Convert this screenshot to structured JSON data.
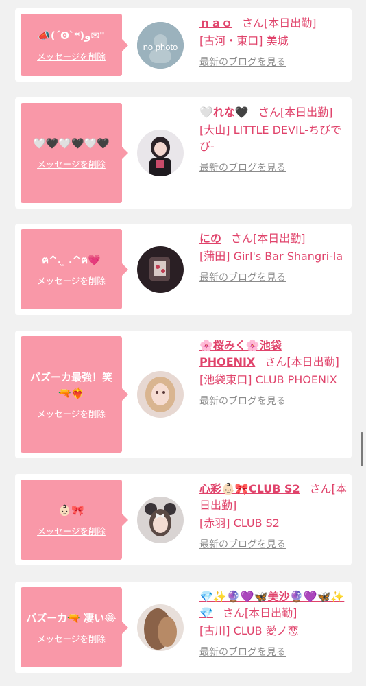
{
  "delete_label": "メッセージを削除",
  "blog_label": "最新のブログを見る",
  "cards": [
    {
      "message": "📣(´ʘ`*)و✉\"",
      "name": "ｎａｏ",
      "san": "さん[本日出勤]",
      "shop": "[古河・東口] 美城",
      "avatar": "no-photo",
      "avatar_text": "no photo"
    },
    {
      "message": "🤍🖤🤍🖤🤍🖤",
      "name": "🤍れな🖤",
      "san": "さん[本日出勤]",
      "shop": "[大山] LITTLE DEVIL-ちびでび-",
      "avatar": "photo-girl-black-dress"
    },
    {
      "message": "ฅ^. ̫ .^ฅ💗",
      "name": "にの",
      "san": "さん[本日出勤]",
      "shop": "[蒲田] Girl's Bar Shangri-la",
      "avatar": "photo-dark-mirror"
    },
    {
      "message": "バズーカ最強！笑🔫❤️‍🔥",
      "name": "🌸桜みく🌸池袋PHOENIX",
      "san": "さん[本日出勤]",
      "shop": "[池袋東口] CLUB PHOENIX",
      "avatar": "photo-blonde-girl"
    },
    {
      "message": "👶🏻🎀",
      "name": "心彩👶🏻🎀CLUB S2",
      "san": "さん[本日出勤]",
      "shop": "[赤羽] CLUB S2",
      "avatar": "photo-girl-mouse-ears"
    },
    {
      "message": "バズーカ🔫 凄い😂",
      "name": "💎✨🔮💜🦋美沙🔮💜🦋✨💎",
      "san": "さん[本日出勤]",
      "shop": "[古川] CLUB 愛ノ恋",
      "avatar": "photo-brown-hair"
    }
  ]
}
